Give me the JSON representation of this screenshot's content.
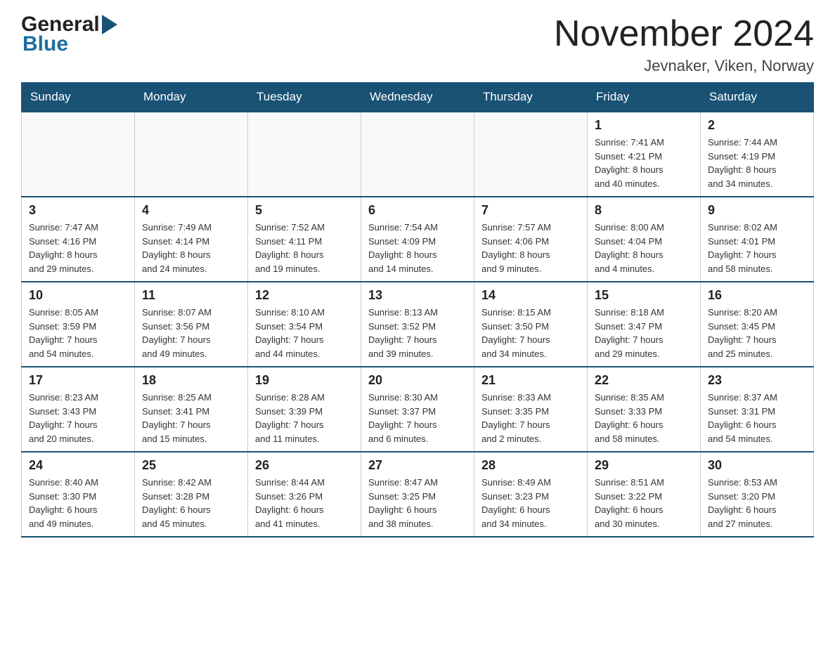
{
  "header": {
    "logo_general": "General",
    "logo_blue": "Blue",
    "title": "November 2024",
    "subtitle": "Jevnaker, Viken, Norway"
  },
  "days_of_week": [
    "Sunday",
    "Monday",
    "Tuesday",
    "Wednesday",
    "Thursday",
    "Friday",
    "Saturday"
  ],
  "weeks": [
    [
      {
        "day": "",
        "info": ""
      },
      {
        "day": "",
        "info": ""
      },
      {
        "day": "",
        "info": ""
      },
      {
        "day": "",
        "info": ""
      },
      {
        "day": "",
        "info": ""
      },
      {
        "day": "1",
        "info": "Sunrise: 7:41 AM\nSunset: 4:21 PM\nDaylight: 8 hours\nand 40 minutes."
      },
      {
        "day": "2",
        "info": "Sunrise: 7:44 AM\nSunset: 4:19 PM\nDaylight: 8 hours\nand 34 minutes."
      }
    ],
    [
      {
        "day": "3",
        "info": "Sunrise: 7:47 AM\nSunset: 4:16 PM\nDaylight: 8 hours\nand 29 minutes."
      },
      {
        "day": "4",
        "info": "Sunrise: 7:49 AM\nSunset: 4:14 PM\nDaylight: 8 hours\nand 24 minutes."
      },
      {
        "day": "5",
        "info": "Sunrise: 7:52 AM\nSunset: 4:11 PM\nDaylight: 8 hours\nand 19 minutes."
      },
      {
        "day": "6",
        "info": "Sunrise: 7:54 AM\nSunset: 4:09 PM\nDaylight: 8 hours\nand 14 minutes."
      },
      {
        "day": "7",
        "info": "Sunrise: 7:57 AM\nSunset: 4:06 PM\nDaylight: 8 hours\nand 9 minutes."
      },
      {
        "day": "8",
        "info": "Sunrise: 8:00 AM\nSunset: 4:04 PM\nDaylight: 8 hours\nand 4 minutes."
      },
      {
        "day": "9",
        "info": "Sunrise: 8:02 AM\nSunset: 4:01 PM\nDaylight: 7 hours\nand 58 minutes."
      }
    ],
    [
      {
        "day": "10",
        "info": "Sunrise: 8:05 AM\nSunset: 3:59 PM\nDaylight: 7 hours\nand 54 minutes."
      },
      {
        "day": "11",
        "info": "Sunrise: 8:07 AM\nSunset: 3:56 PM\nDaylight: 7 hours\nand 49 minutes."
      },
      {
        "day": "12",
        "info": "Sunrise: 8:10 AM\nSunset: 3:54 PM\nDaylight: 7 hours\nand 44 minutes."
      },
      {
        "day": "13",
        "info": "Sunrise: 8:13 AM\nSunset: 3:52 PM\nDaylight: 7 hours\nand 39 minutes."
      },
      {
        "day": "14",
        "info": "Sunrise: 8:15 AM\nSunset: 3:50 PM\nDaylight: 7 hours\nand 34 minutes."
      },
      {
        "day": "15",
        "info": "Sunrise: 8:18 AM\nSunset: 3:47 PM\nDaylight: 7 hours\nand 29 minutes."
      },
      {
        "day": "16",
        "info": "Sunrise: 8:20 AM\nSunset: 3:45 PM\nDaylight: 7 hours\nand 25 minutes."
      }
    ],
    [
      {
        "day": "17",
        "info": "Sunrise: 8:23 AM\nSunset: 3:43 PM\nDaylight: 7 hours\nand 20 minutes."
      },
      {
        "day": "18",
        "info": "Sunrise: 8:25 AM\nSunset: 3:41 PM\nDaylight: 7 hours\nand 15 minutes."
      },
      {
        "day": "19",
        "info": "Sunrise: 8:28 AM\nSunset: 3:39 PM\nDaylight: 7 hours\nand 11 minutes."
      },
      {
        "day": "20",
        "info": "Sunrise: 8:30 AM\nSunset: 3:37 PM\nDaylight: 7 hours\nand 6 minutes."
      },
      {
        "day": "21",
        "info": "Sunrise: 8:33 AM\nSunset: 3:35 PM\nDaylight: 7 hours\nand 2 minutes."
      },
      {
        "day": "22",
        "info": "Sunrise: 8:35 AM\nSunset: 3:33 PM\nDaylight: 6 hours\nand 58 minutes."
      },
      {
        "day": "23",
        "info": "Sunrise: 8:37 AM\nSunset: 3:31 PM\nDaylight: 6 hours\nand 54 minutes."
      }
    ],
    [
      {
        "day": "24",
        "info": "Sunrise: 8:40 AM\nSunset: 3:30 PM\nDaylight: 6 hours\nand 49 minutes."
      },
      {
        "day": "25",
        "info": "Sunrise: 8:42 AM\nSunset: 3:28 PM\nDaylight: 6 hours\nand 45 minutes."
      },
      {
        "day": "26",
        "info": "Sunrise: 8:44 AM\nSunset: 3:26 PM\nDaylight: 6 hours\nand 41 minutes."
      },
      {
        "day": "27",
        "info": "Sunrise: 8:47 AM\nSunset: 3:25 PM\nDaylight: 6 hours\nand 38 minutes."
      },
      {
        "day": "28",
        "info": "Sunrise: 8:49 AM\nSunset: 3:23 PM\nDaylight: 6 hours\nand 34 minutes."
      },
      {
        "day": "29",
        "info": "Sunrise: 8:51 AM\nSunset: 3:22 PM\nDaylight: 6 hours\nand 30 minutes."
      },
      {
        "day": "30",
        "info": "Sunrise: 8:53 AM\nSunset: 3:20 PM\nDaylight: 6 hours\nand 27 minutes."
      }
    ]
  ],
  "colors": {
    "header_bg": "#1a5276",
    "header_text": "#ffffff",
    "border": "#1a5276",
    "cell_border": "#cccccc"
  }
}
